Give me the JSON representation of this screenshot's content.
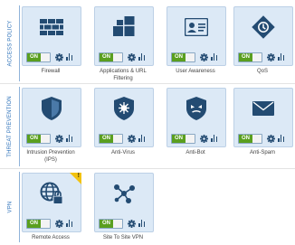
{
  "sections": [
    {
      "label": "ACCESS POLICY",
      "blades": [
        {
          "name": "Firewall",
          "icon": "firewall-icon",
          "toggle": "ON"
        },
        {
          "name": "Applications & URL Filtering",
          "icon": "applications-icon",
          "toggle": "ON"
        },
        {
          "name": "User Awareness",
          "icon": "user-card-icon",
          "toggle": "ON"
        },
        {
          "name": "QoS",
          "icon": "qos-icon",
          "toggle": "ON"
        }
      ]
    },
    {
      "label": "THREAT PREVENTION",
      "blades": [
        {
          "name": "Intrusion Prevention (IPS)",
          "icon": "shield-icon",
          "toggle": "ON"
        },
        {
          "name": "Anti-Virus",
          "icon": "virus-shield-icon",
          "toggle": "ON"
        },
        {
          "name": "Anti-Bot",
          "icon": "bot-shield-icon",
          "toggle": "ON"
        },
        {
          "name": "Anti-Spam",
          "icon": "envelope-icon",
          "toggle": "ON"
        }
      ]
    },
    {
      "label": "VPN",
      "blades": [
        {
          "name": "Remote Access",
          "icon": "globe-lock-icon",
          "toggle": "ON",
          "warning": "!"
        },
        {
          "name": "Site To Site VPN",
          "icon": "network-nodes-icon",
          "toggle": "ON"
        }
      ]
    }
  ],
  "colors": {
    "card_bg": "#dce9f6",
    "icon": "#234b72",
    "toggle_on": "#5a9f1f",
    "section_label": "#2a6fb8",
    "warning": "#f2c20f"
  }
}
